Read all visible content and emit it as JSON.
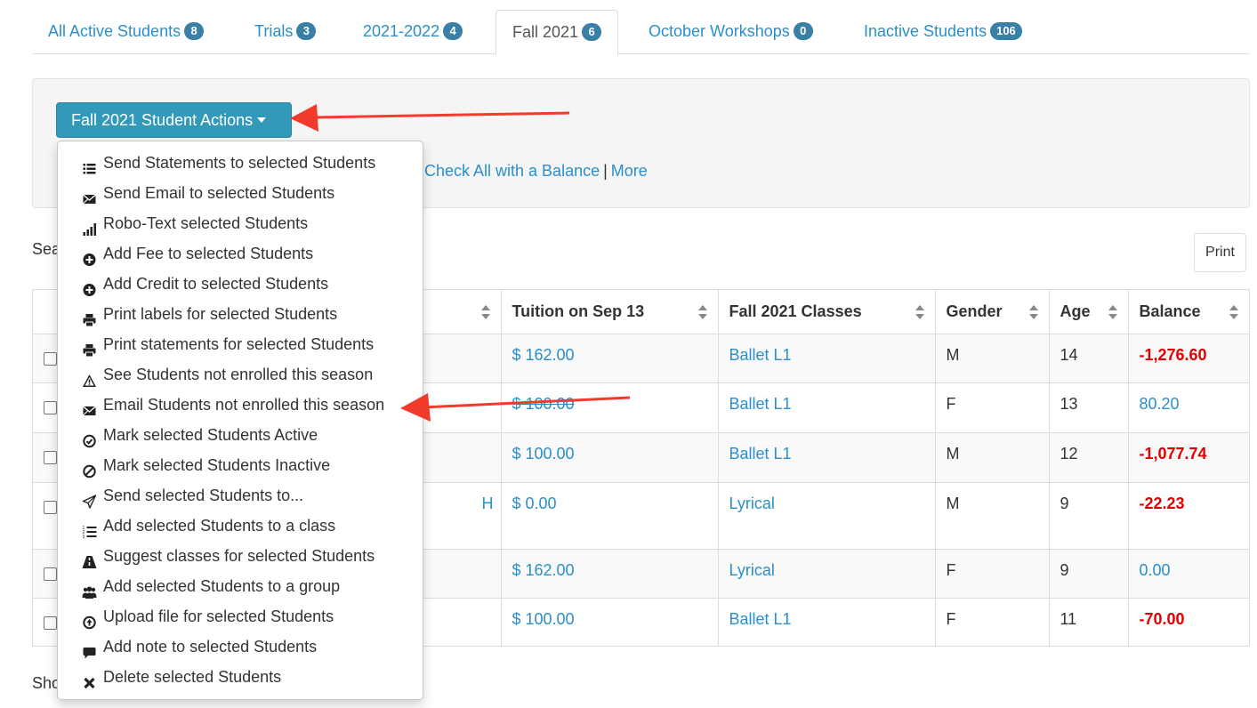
{
  "tabs": [
    {
      "label": "All Active Students",
      "count": "8"
    },
    {
      "label": "Trials",
      "count": "3"
    },
    {
      "label": "2021-2022",
      "count": "4"
    },
    {
      "label": "Fall 2021",
      "count": "6",
      "active": true
    },
    {
      "label": "October Workshops",
      "count": "0"
    },
    {
      "label": "Inactive Students",
      "count": "106"
    }
  ],
  "actions_button": "Fall 2021 Student Actions",
  "check_links": {
    "balance": "Check All with a Balance",
    "sep": "|",
    "more": "More"
  },
  "partial_text": {
    "search": "Sea",
    "show": "Sho"
  },
  "print_button": "Print",
  "table": {
    "headers": [
      "",
      "Tuition on Sep 13",
      "Fall 2021 Classes",
      "Gender",
      "Age",
      "Balance"
    ],
    "rows": [
      {
        "name_tail": "",
        "tuition": "$ 162.00",
        "tuition_struck": false,
        "class": "Ballet L1",
        "gender": "M",
        "age": "14",
        "balance": "-1,276.60",
        "negative": true
      },
      {
        "name_tail": "",
        "tuition": "$ 100.00",
        "tuition_struck": true,
        "class": "Ballet L1",
        "gender": "F",
        "age": "13",
        "balance": "80.20",
        "negative": false
      },
      {
        "name_tail": "",
        "tuition": "$ 100.00",
        "tuition_struck": false,
        "class": "Ballet L1",
        "gender": "M",
        "age": "12",
        "balance": "-1,077.74",
        "negative": true
      },
      {
        "name_tail": "H",
        "tuition": "$ 0.00",
        "tuition_struck": false,
        "class": "Lyrical",
        "gender": "M",
        "age": "9",
        "balance": "-22.23",
        "negative": true
      },
      {
        "name_tail": "",
        "tuition": "$ 162.00",
        "tuition_struck": false,
        "class": "Lyrical",
        "gender": "F",
        "age": "9",
        "balance": "0.00",
        "negative": false
      },
      {
        "name_tail": "",
        "tuition": "$ 100.00",
        "tuition_struck": false,
        "class": "Ballet L1",
        "gender": "F",
        "age": "11",
        "balance": "-70.00",
        "negative": true
      }
    ]
  },
  "menu": [
    {
      "label": "Send Statements to selected Students",
      "icon": "list-icon"
    },
    {
      "label": "Send Email to selected Students",
      "icon": "envelope-icon"
    },
    {
      "label": "Robo-Text selected Students",
      "icon": "signal-icon"
    },
    {
      "label": "Add Fee to selected Students",
      "icon": "plus-circle-icon"
    },
    {
      "label": "Add Credit to selected Students",
      "icon": "plus-circle-icon"
    },
    {
      "label": "Print labels for selected Students",
      "icon": "printer-icon"
    },
    {
      "label": "Print statements for selected Students",
      "icon": "printer-icon"
    },
    {
      "label": "See Students not enrolled this season",
      "icon": "warning-icon"
    },
    {
      "label": "Email Students not enrolled this season",
      "icon": "envelope-icon"
    },
    {
      "label": "Mark selected Students Active",
      "icon": "check-circle-icon"
    },
    {
      "label": "Mark selected Students Inactive",
      "icon": "ban-circle-icon"
    },
    {
      "label": "Send selected Students to...",
      "icon": "send-icon"
    },
    {
      "label": "Add selected Students to a class",
      "icon": "numbered-list-icon"
    },
    {
      "label": "Suggest classes for selected Students",
      "icon": "road-icon"
    },
    {
      "label": "Add selected Students to a group",
      "icon": "group-icon"
    },
    {
      "label": "Upload file for selected Students",
      "icon": "upload-circle-icon"
    },
    {
      "label": "Add note to selected Students",
      "icon": "comment-icon"
    },
    {
      "label": "Delete selected Students",
      "icon": "remove-icon"
    }
  ],
  "colors": {
    "link": "#2a8fc9",
    "badge": "#3a7fa5",
    "primary_button": "#3399b8",
    "negative_balance": "#e00000",
    "annotation_arrow": "#f23b2d"
  }
}
